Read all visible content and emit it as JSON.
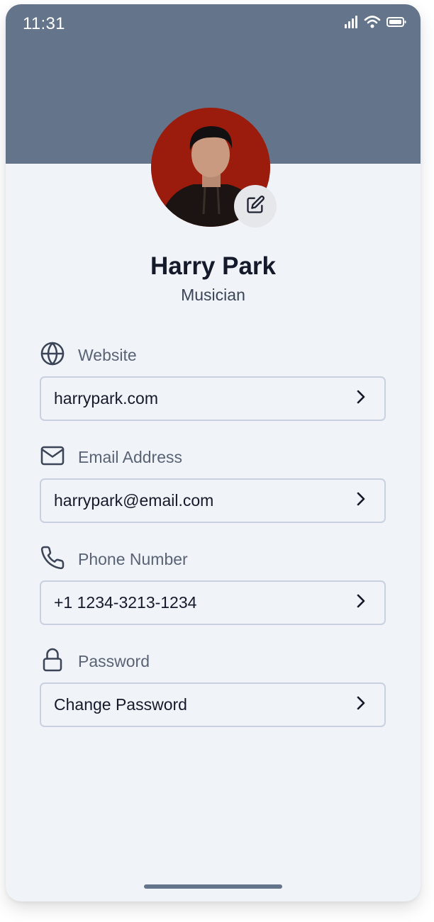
{
  "status_bar": {
    "time": "11:31",
    "icons": [
      "cellular-signal-icon",
      "wifi-icon",
      "battery-icon"
    ]
  },
  "profile": {
    "name": "Harry Park",
    "role": "Musician",
    "edit_icon": "edit-icon"
  },
  "fields": [
    {
      "label": "Website",
      "value": "harrypark.com",
      "icon": "globe-icon"
    },
    {
      "label": "Email Address",
      "value": "harrypark@email.com",
      "icon": "mail-icon"
    },
    {
      "label": "Phone Number",
      "value": "+1 1234-3213-1234",
      "icon": "phone-icon"
    },
    {
      "label": "Password",
      "value": "Change Password",
      "icon": "lock-icon"
    }
  ],
  "colors": {
    "header": "#64748b",
    "background": "#f0f3f8",
    "text_primary": "#151a2b",
    "text_secondary": "#5a6376",
    "border": "#c9d1e0"
  }
}
